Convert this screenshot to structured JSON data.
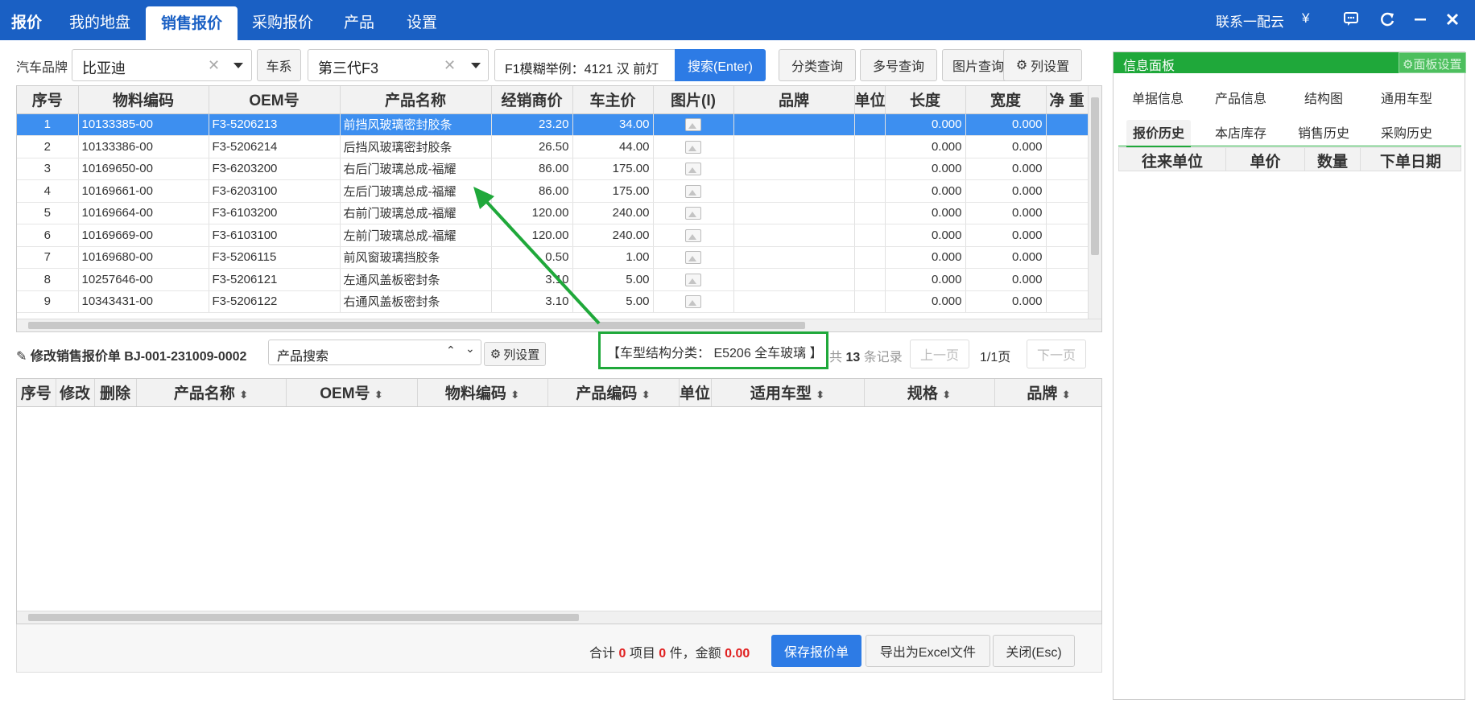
{
  "nav": {
    "brand": "报价",
    "tabs": [
      "我的地盘",
      "销售报价",
      "采购报价",
      "产品",
      "设置"
    ],
    "active_tab": "销售报价",
    "contact": "联系一配云",
    "yen": "¥",
    "accent": "#1a60c4"
  },
  "search": {
    "brand_label": "汽车品牌",
    "brand_value": "比亚迪",
    "series_button": "车系",
    "series_value": "第三代F3",
    "query_placeholder": "F1模糊举例：4121 汉 前灯",
    "search_button": "搜索(Enter)",
    "category_button": "分类查询",
    "multi_button": "多号查询",
    "image_button": "图片查询",
    "columns_button": "列设置"
  },
  "product_grid": {
    "columns": [
      "序号",
      "物料编码",
      "OEM号",
      "产品名称",
      "经销商价",
      "车主价",
      "图片(I)",
      "品牌",
      "单位",
      "长度",
      "宽度",
      "净 重"
    ],
    "rows": [
      [
        "1",
        "10133385-00",
        "F3-5206213",
        "前挡风玻璃密封胶条",
        "23.20",
        "34.00",
        "",
        "",
        "",
        "0.000",
        "0.000"
      ],
      [
        "2",
        "10133386-00",
        "F3-5206214",
        "后挡风玻璃密封胶条",
        "26.50",
        "44.00",
        "",
        "",
        "",
        "0.000",
        "0.000"
      ],
      [
        "3",
        "10169650-00",
        "F3-6203200",
        "右后门玻璃总成-福耀",
        "86.00",
        "175.00",
        "",
        "",
        "",
        "0.000",
        "0.000"
      ],
      [
        "4",
        "10169661-00",
        "F3-6203100",
        "左后门玻璃总成-福耀",
        "86.00",
        "175.00",
        "",
        "",
        "",
        "0.000",
        "0.000"
      ],
      [
        "5",
        "10169664-00",
        "F3-6103200",
        "右前门玻璃总成-福耀",
        "120.00",
        "240.00",
        "",
        "",
        "",
        "0.000",
        "0.000"
      ],
      [
        "6",
        "10169669-00",
        "F3-6103100",
        "左前门玻璃总成-福耀",
        "120.00",
        "240.00",
        "",
        "",
        "",
        "0.000",
        "0.000"
      ],
      [
        "7",
        "10169680-00",
        "F3-5206115",
        "前风窗玻璃挡胶条",
        "0.50",
        "1.00",
        "",
        "",
        "",
        "0.000",
        "0.000"
      ],
      [
        "8",
        "10257646-00",
        "F3-5206121",
        "左通风盖板密封条",
        "3.10",
        "5.00",
        "",
        "",
        "",
        "0.000",
        "0.000"
      ],
      [
        "9",
        "10343431-00",
        "F3-5206122",
        "右通风盖板密封条",
        "3.10",
        "5.00",
        "",
        "",
        "",
        "0.000",
        "0.000"
      ]
    ],
    "selected_row": 0
  },
  "quote": {
    "title": "修改销售报价单 BJ-001-231009-0002",
    "search_placeholder": "产品搜索",
    "columns_button": "列设置",
    "category": "【车型结构分类： E5206 全车玻璃 】",
    "total_prefix": "共",
    "total_count": "13",
    "total_suffix": "条记录",
    "prev": "上一页",
    "page": "1/1页",
    "next": "下一页",
    "columns": [
      "序号",
      "修改",
      "删除",
      "产品名称",
      "OEM号",
      "物料编码",
      "产品编码",
      "单位",
      "适用车型",
      "规格",
      "品牌"
    ],
    "summary_prefix": "合计",
    "items": "0",
    "items_label": "项目",
    "pieces": "0",
    "pieces_label": "件，金额",
    "amount": "0.00",
    "save_button": "保存报价单",
    "export_button": "导出为Excel文件",
    "close_button": "关闭(Esc)"
  },
  "panel": {
    "title": "信息面板",
    "settings_button": "面板设置",
    "tabs_row1": [
      "单据信息",
      "产品信息",
      "结构图",
      "通用车型"
    ],
    "tabs_row2": [
      "报价历史",
      "本店库存",
      "销售历史",
      "采购历史"
    ],
    "active_tab": "报价历史",
    "columns": [
      "往来单位",
      "单价",
      "数量",
      "下单日期"
    ],
    "accent": "#1fa83a"
  },
  "highlight_color": "#1fa83a"
}
